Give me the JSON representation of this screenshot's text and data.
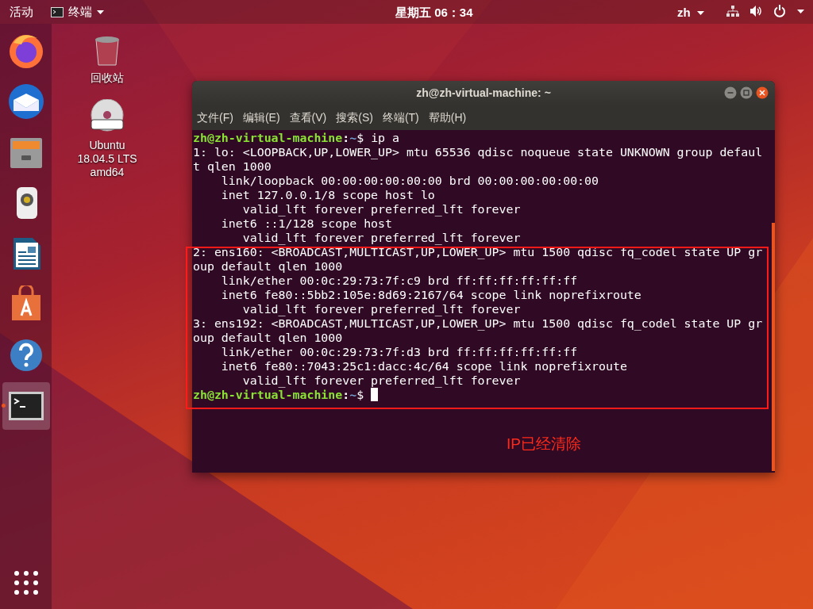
{
  "top_bar": {
    "activities": "活动",
    "app_menu": "终端",
    "clock": "星期五 06：34",
    "input_method": "zh"
  },
  "dock": {
    "items": [
      {
        "kind": "firefox",
        "selected": false
      },
      {
        "kind": "thunderbird",
        "selected": false
      },
      {
        "kind": "files",
        "selected": false
      },
      {
        "kind": "rhythmbox",
        "selected": false
      },
      {
        "kind": "writer",
        "selected": false
      },
      {
        "kind": "software",
        "selected": false
      },
      {
        "kind": "help",
        "selected": false
      },
      {
        "kind": "terminal",
        "selected": true
      }
    ]
  },
  "desktop_icons": [
    {
      "kind": "trash",
      "lines": [
        "回收站"
      ]
    },
    {
      "kind": "dvd",
      "lines": [
        "Ubuntu",
        "18.04.5 LTS",
        "amd64"
      ]
    }
  ],
  "terminal": {
    "title": "zh@zh-virtual-machine: ~",
    "menu": [
      "文件(F)",
      "编辑(E)",
      "查看(V)",
      "搜索(S)",
      "终端(T)",
      "帮助(H)"
    ],
    "lines": [
      {
        "kind": "prompt",
        "user_host": "zh@zh-virtual-machine",
        "separator": ":",
        "path": "~",
        "command": "$ ip a",
        "cursor": false
      },
      {
        "kind": "output",
        "text": "1: lo: <LOOPBACK,UP,LOWER_UP> mtu 65536 qdisc noqueue state UNKNOWN group defaul"
      },
      {
        "kind": "output",
        "text": "t qlen 1000"
      },
      {
        "kind": "output",
        "text": "    link/loopback 00:00:00:00:00:00 brd 00:00:00:00:00:00"
      },
      {
        "kind": "output",
        "text": "    inet 127.0.0.1/8 scope host lo"
      },
      {
        "kind": "output",
        "text": "       valid_lft forever preferred_lft forever"
      },
      {
        "kind": "output",
        "text": "    inet6 ::1/128 scope host"
      },
      {
        "kind": "output",
        "text": "       valid_lft forever preferred_lft forever"
      },
      {
        "kind": "output",
        "text": "2: ens160: <BROADCAST,MULTICAST,UP,LOWER_UP> mtu 1500 qdisc fq_codel state UP gr"
      },
      {
        "kind": "output",
        "text": "oup default qlen 1000"
      },
      {
        "kind": "output",
        "text": "    link/ether 00:0c:29:73:7f:c9 brd ff:ff:ff:ff:ff:ff"
      },
      {
        "kind": "output",
        "text": "    inet6 fe80::5bb2:105e:8d69:2167/64 scope link noprefixroute"
      },
      {
        "kind": "output",
        "text": "       valid_lft forever preferred_lft forever"
      },
      {
        "kind": "output",
        "text": "3: ens192: <BROADCAST,MULTICAST,UP,LOWER_UP> mtu 1500 qdisc fq_codel state UP gr"
      },
      {
        "kind": "output",
        "text": "oup default qlen 1000"
      },
      {
        "kind": "output",
        "text": "    link/ether 00:0c:29:73:7f:d3 brd ff:ff:ff:ff:ff:ff"
      },
      {
        "kind": "output",
        "text": "    inet6 fe80::7043:25c1:dacc:4c/64 scope link noprefixroute"
      },
      {
        "kind": "output",
        "text": "       valid_lft forever preferred_lft forever"
      },
      {
        "kind": "prompt",
        "user_host": "zh@zh-virtual-machine",
        "separator": ":",
        "path": "~",
        "command": "$ ",
        "cursor": true
      }
    ]
  },
  "annotation": {
    "text": "IP已经清除"
  }
}
